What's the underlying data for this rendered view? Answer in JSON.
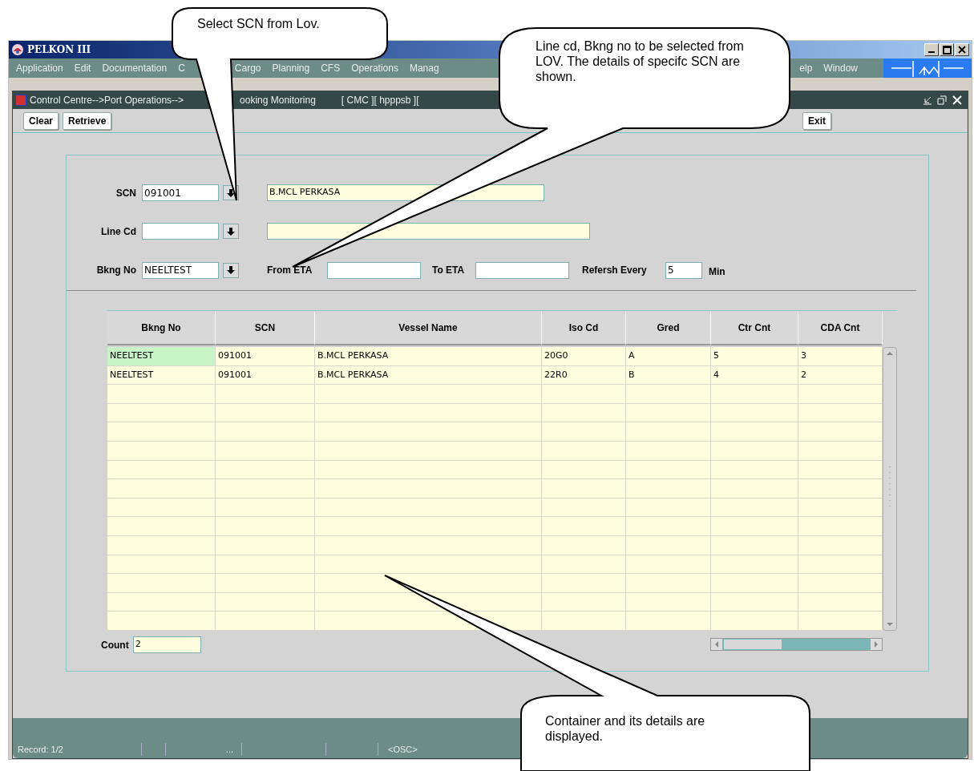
{
  "window": {
    "title": "PELKON III"
  },
  "menu_groups": [
    [
      "Application",
      "Edit",
      "Documentation",
      "C"
    ],
    [
      "Cargo",
      "Planning",
      "CFS",
      "Operations",
      "Manag"
    ],
    [
      "elp",
      "Window"
    ]
  ],
  "form_title": {
    "parts": [
      "Control Centre-->Port Operations-->",
      "ooking Monitoring",
      "[  CMC  ][  hpppsb  ]["
    ]
  },
  "toolbar": {
    "left": [
      "Clear",
      "Retrieve"
    ],
    "right": [
      "Exit"
    ]
  },
  "fields": {
    "scn": {
      "label": "SCN",
      "value": "091001",
      "description": "B.MCL PERKASA"
    },
    "line_cd": {
      "label": "Line Cd"
    },
    "bkng_no": {
      "label": "Bkng No",
      "value": "NEELTEST"
    },
    "from_eta": {
      "label": "From ETA"
    },
    "to_eta": {
      "label": "To ETA"
    },
    "refresh": {
      "label": "Refersh Every",
      "value": "5",
      "unit": "Min"
    }
  },
  "table": {
    "columns": [
      "Bkng No",
      "SCN",
      "Vessel Name",
      "Iso Cd",
      "Gred",
      "Ctr Cnt",
      "CDA Cnt"
    ],
    "rows": [
      {
        "current": true,
        "cells": [
          "NEELTEST",
          "091001",
          "B.MCL PERKASA",
          "20G0",
          "A",
          "5",
          "3"
        ]
      },
      {
        "current": false,
        "cells": [
          "NEELTEST",
          "091001",
          "B.MCL PERKASA",
          "22R0",
          "B",
          "4",
          "2"
        ]
      }
    ]
  },
  "count": {
    "label": "Count",
    "value": "2"
  },
  "status_bar": {
    "record": "Record: 1/2",
    "ellipsis": "...",
    "mode": "<OSC>"
  },
  "callouts": [
    {
      "text": "Select  SCN from Lov."
    },
    {
      "text": "Line cd, Bkng no  to be selected from LOV. The details of specifc SCN are shown."
    },
    {
      "text": "Container and its details are displayed."
    }
  ]
}
